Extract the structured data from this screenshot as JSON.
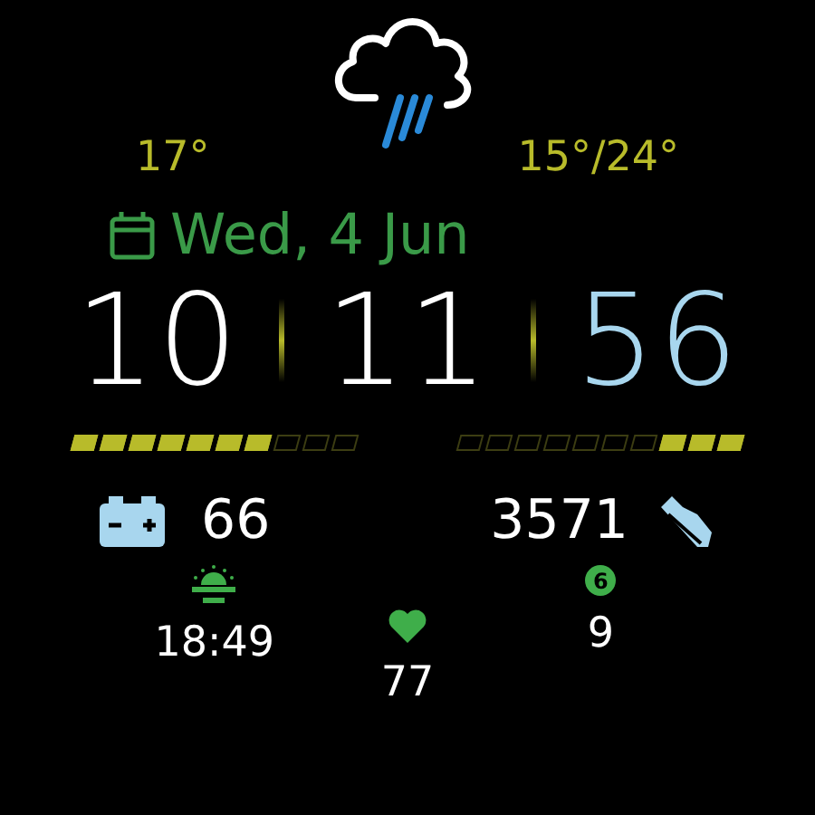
{
  "weather": {
    "current_temp": "17°",
    "range": "15°/24°"
  },
  "date": "Wed, 4 Jun",
  "time": {
    "hours": "10",
    "minutes": "11",
    "seconds": "56"
  },
  "bars": [
    {
      "level": 0.7,
      "kind": "forward"
    },
    {
      "level": 0.3,
      "kind": "reverse"
    }
  ],
  "battery": "66",
  "steps": "3571",
  "sunset": "18:49",
  "heart_rate": "77",
  "notifications": {
    "badge": "6",
    "value": "9"
  }
}
